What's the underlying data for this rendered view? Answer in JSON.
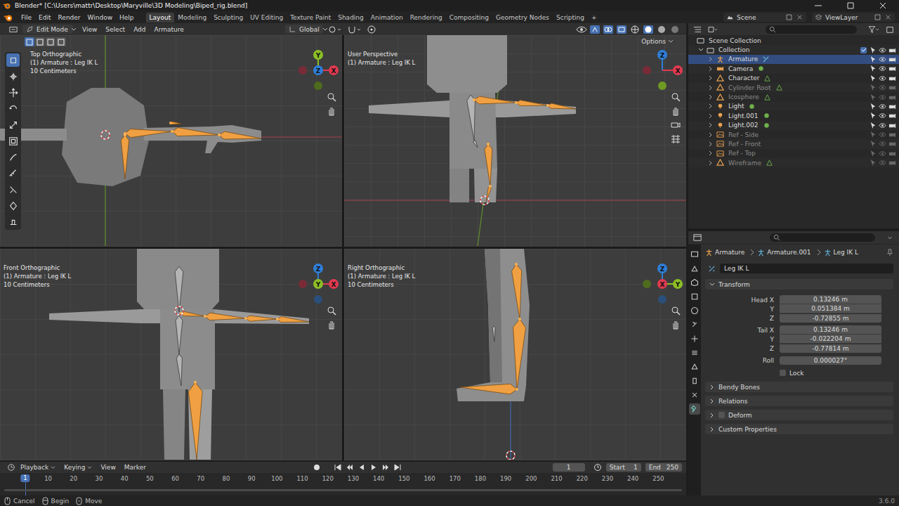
{
  "window": {
    "title": "Blender* [C:\\Users\\mattr\\Desktop\\Maryville\\3D Modeling\\Biped_rig.blend]"
  },
  "menus": [
    "File",
    "Edit",
    "Render",
    "Window",
    "Help"
  ],
  "workspaces": [
    {
      "label": "Layout",
      "selected": true
    },
    {
      "label": "Modeling",
      "selected": false
    },
    {
      "label": "Sculpting",
      "selected": false
    },
    {
      "label": "UV Editing",
      "selected": false
    },
    {
      "label": "Texture Paint",
      "selected": false
    },
    {
      "label": "Shading",
      "selected": false
    },
    {
      "label": "Animation",
      "selected": false
    },
    {
      "label": "Rendering",
      "selected": false
    },
    {
      "label": "Compositing",
      "selected": false
    },
    {
      "label": "Geometry Nodes",
      "selected": false
    },
    {
      "label": "Scripting",
      "selected": false
    }
  ],
  "add_workspace": "+",
  "scene": "Scene",
  "view_layer": "ViewLayer",
  "header": {
    "mode": "Edit Mode",
    "menus": [
      "View",
      "Select",
      "Add",
      "Armature"
    ],
    "orientation": "Global",
    "options": "Options"
  },
  "select_modes": [
    {
      "selected": true
    },
    {
      "selected": false
    },
    {
      "selected": false
    },
    {
      "selected": false
    }
  ],
  "toolbar": [
    {
      "selected": true
    },
    {
      "selected": false
    },
    {
      "selected": false
    },
    {
      "selected": false
    },
    {
      "selected": false
    },
    {
      "selected": false
    },
    {
      "selected": false
    },
    {
      "selected": false
    },
    {
      "selected": false
    },
    {
      "selected": false
    },
    {
      "selected": false
    }
  ],
  "viewports": [
    {
      "kind": "top",
      "name": "Top Orthographic",
      "object": "(1) Armature : Leg IK L",
      "scale": "10 Centimeters",
      "gizmo": [
        {
          "dir": "left",
          "color": "#7a2b38"
        },
        {
          "dir": "down",
          "color": "#4f6b1e"
        },
        {
          "label": "Y",
          "dir": "up",
          "color": "#8cbf26"
        },
        {
          "label": "X",
          "dir": "right",
          "color": "#e03a50"
        },
        {
          "label": "Z",
          "dir": "center",
          "color": "#2f7fd8"
        }
      ]
    },
    {
      "kind": "persp",
      "name": "User Perspective",
      "object": "(1) Armature : Leg IK L",
      "gizmo": [
        {
          "dir": "left",
          "color": "#7a2b38"
        },
        {
          "dir": "down",
          "color": "#6f9a22"
        },
        {
          "label": "Z",
          "dir": "up",
          "color": "#2f7fd8"
        },
        {
          "label": "X",
          "dir": "right",
          "color": "#e03a50"
        }
      ]
    },
    {
      "kind": "front",
      "name": "Front Orthographic",
      "object": "(1) Armature : Leg IK L",
      "scale": "10 Centimeters",
      "gizmo": [
        {
          "dir": "left",
          "color": "#7a2b38"
        },
        {
          "dir": "down",
          "color": "#2a4f7a"
        },
        {
          "label": "Z",
          "dir": "up",
          "color": "#2f7fd8"
        },
        {
          "label": "X",
          "dir": "right",
          "color": "#e03a50"
        },
        {
          "label": "Y",
          "dir": "center",
          "color": "#8cbf26"
        }
      ]
    },
    {
      "kind": "right",
      "name": "Right Orthographic",
      "object": "(1) Armature : Leg IK L",
      "scale": "10 Centimeters",
      "gizmo": [
        {
          "dir": "left",
          "color": "#4f6b1e"
        },
        {
          "dir": "down",
          "color": "#2a4f7a"
        },
        {
          "label": "Z",
          "dir": "up",
          "color": "#2f7fd8"
        },
        {
          "label": "Y",
          "dir": "right",
          "color": "#8cbf26"
        },
        {
          "label": "X",
          "dir": "center",
          "color": "#e03a50"
        }
      ]
    }
  ],
  "outliner": {
    "root": "Scene Collection",
    "collection": {
      "name": "Collection",
      "checked": true
    },
    "items": [
      {
        "name": "Armature",
        "kind": "armature",
        "selected": true,
        "visible": true
      },
      {
        "name": "Camera",
        "kind": "camera",
        "selected": false,
        "visible": true
      },
      {
        "name": "Character",
        "kind": "mesh",
        "selected": false,
        "visible": true
      },
      {
        "name": "Cylinder Root",
        "kind": "mesh",
        "selected": false,
        "visible": false
      },
      {
        "name": "Icosphere",
        "kind": "mesh",
        "selected": false,
        "visible": false
      },
      {
        "name": "Light",
        "kind": "light",
        "selected": false,
        "visible": true
      },
      {
        "name": "Light.001",
        "kind": "light",
        "selected": false,
        "visible": true
      },
      {
        "name": "Light.002",
        "kind": "light",
        "selected": false,
        "visible": true
      },
      {
        "name": "Ref - Side",
        "kind": "image",
        "selected": false,
        "visible": false
      },
      {
        "name": "Ref - Front",
        "kind": "image",
        "selected": false,
        "visible": false
      },
      {
        "name": "Ref - Top",
        "kind": "image",
        "selected": false,
        "visible": false
      },
      {
        "name": "Wireframe",
        "kind": "mesh",
        "selected": false,
        "visible": false
      }
    ]
  },
  "properties": {
    "breadcrumb": [
      "Armature",
      "Armature.001",
      "Leg IK L"
    ],
    "name": "Leg IK L",
    "tabs": [
      {
        "selected": false
      },
      {
        "selected": false
      },
      {
        "selected": false
      },
      {
        "selected": false
      },
      {
        "selected": false
      },
      {
        "selected": false
      },
      {
        "selected": false
      },
      {
        "selected": false
      },
      {
        "selected": false
      },
      {
        "selected": false
      },
      {
        "selected": false
      },
      {
        "selected": true
      }
    ],
    "section": {
      "label": "Transform",
      "expanded": true
    },
    "groups": [
      [
        {
          "label": "Head X",
          "value": "0.13246 m"
        },
        {
          "label": "Y",
          "value": "0.051384 m"
        },
        {
          "label": "Z",
          "value": "-0.72855 m"
        }
      ],
      [
        {
          "label": "Tail X",
          "value": "0.13246 m"
        },
        {
          "label": "Y",
          "value": "-0.022204 m"
        },
        {
          "label": "Z",
          "value": "-0.77814 m"
        }
      ],
      [
        {
          "label": "Roll",
          "value": "0.000027°"
        }
      ]
    ],
    "lock": {
      "label": "Lock",
      "checked": false
    },
    "panels": [
      {
        "label": "Bendy Bones",
        "kind": "plain",
        "expanded": false
      },
      {
        "label": "Relations",
        "kind": "plain",
        "expanded": false
      },
      {
        "label": "Deform",
        "kind": "checkbox",
        "checked": false,
        "expanded": false
      },
      {
        "label": "Custom Properties",
        "kind": "plain",
        "expanded": false
      }
    ]
  },
  "timeline": {
    "menus": [
      "Playback",
      "Keying",
      "View",
      "Marker"
    ],
    "frame": "1",
    "start_label": "Start",
    "start": "1",
    "end_label": "End",
    "end": "250",
    "current": "1",
    "ticks": [
      "10",
      "20",
      "30",
      "40",
      "50",
      "60",
      "70",
      "80",
      "90",
      "100",
      "110",
      "120",
      "130",
      "140",
      "150",
      "160",
      "170",
      "180",
      "190",
      "200",
      "210",
      "220",
      "230",
      "240",
      "250"
    ]
  },
  "status": {
    "items": [
      "Cancel",
      "Begin",
      "Move"
    ],
    "version": "3.6.0"
  }
}
